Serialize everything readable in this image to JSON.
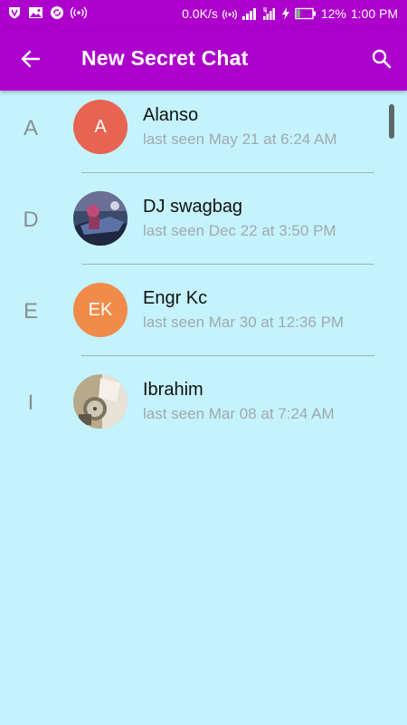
{
  "status_bar": {
    "speed": "0.0K/s",
    "battery": "12%",
    "time": "1:00 PM"
  },
  "header": {
    "title": "New Secret Chat",
    "back_icon": "arrow-left-icon",
    "search_icon": "search-icon"
  },
  "colors": {
    "brand": "#ad00cc",
    "background": "#c4f3fd",
    "avatar_a": "#e86452",
    "avatar_ek": "#f18b4a"
  },
  "contacts": [
    {
      "section": "A",
      "name": "Alanso",
      "status": "last seen May 21 at 6:24 AM",
      "initials": "A"
    },
    {
      "section": "D",
      "name": "DJ swagbag",
      "status": "last seen Dec 22 at 3:50 PM",
      "initials": ""
    },
    {
      "section": "E",
      "name": "Engr Kc",
      "status": "last seen Mar 30 at 12:36 PM",
      "initials": "EK"
    },
    {
      "section": "I",
      "name": "Ibrahim",
      "status": "last seen Mar 08 at 7:24 AM",
      "initials": ""
    }
  ]
}
